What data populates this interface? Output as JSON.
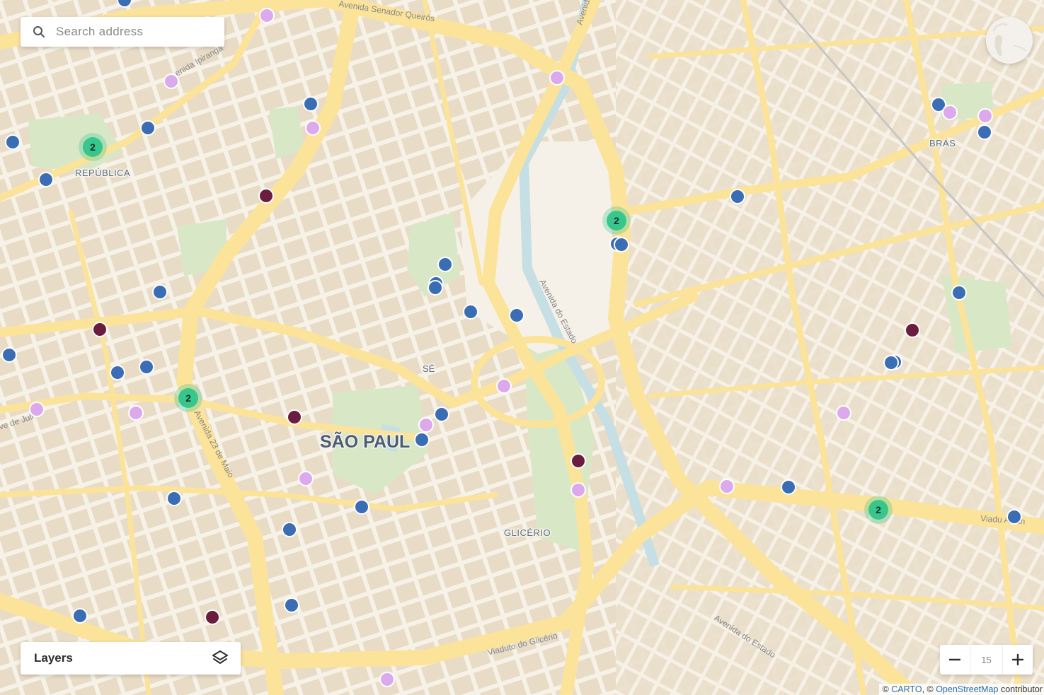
{
  "search": {
    "placeholder": "Search address"
  },
  "layers": {
    "label": "Layers"
  },
  "zoom": {
    "level": "15"
  },
  "attribution": {
    "prefix": "©",
    "carto": "CARTO",
    "separator": ", ©",
    "osm": "OpenStreetMap",
    "suffix": "contributor"
  },
  "map": {
    "city_label": "SÃO PAUL",
    "district_labels": [
      "REPÚBLICA",
      "SÉ",
      "GLICÉRIO",
      "BRÁS"
    ],
    "street_labels": [
      "Avenida Senador Queirós",
      "Avenida",
      "enida Ipiranga",
      "Avenida do Estado",
      "Avenida 23 de Maio",
      "ve de Juli",
      "Viaduto do Glicério",
      "Avenida do Estado",
      "Viadu Alcân"
    ],
    "cluster_count": "2",
    "colors": {
      "blue": "#3a6db3",
      "lilac": "#dca9ec",
      "maroon": "#6b1d3f",
      "cluster": "#37c78c",
      "road": "#fbe39a",
      "block": "#e9dcc7",
      "park": "#d8e8c7",
      "water": "#c5dfe4"
    }
  }
}
